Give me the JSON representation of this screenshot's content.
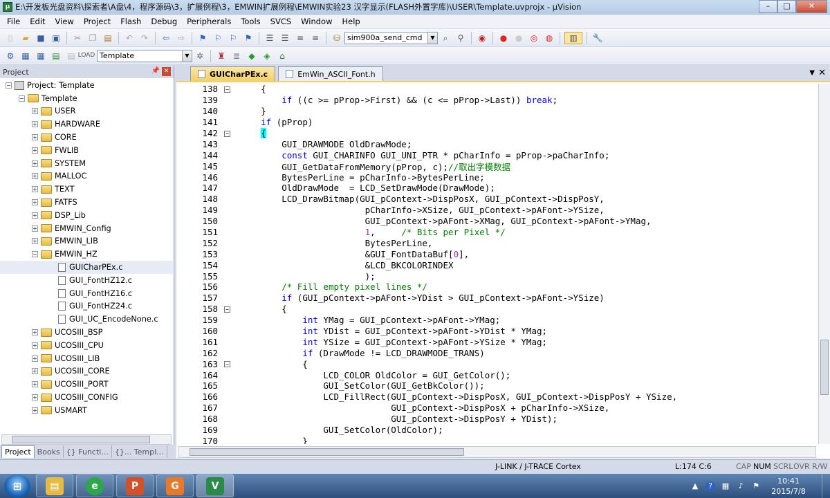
{
  "window": {
    "title": "E:\\开发板光盘资料\\探索者\\A盘\\4，程序源码\\3，扩展例程\\3，EMWIN扩展例程\\EMWIN实验23 汉字显示(FLASH外置字库)\\USER\\Template.uvprojx - µVision",
    "btn_min": "–",
    "btn_max": "□",
    "btn_close": "✕"
  },
  "menu": [
    "File",
    "Edit",
    "View",
    "Project",
    "Flash",
    "Debug",
    "Peripherals",
    "Tools",
    "SVCS",
    "Window",
    "Help"
  ],
  "toolbar": {
    "find_combo": "sim900a_send_cmd",
    "target_combo": "Template",
    "combo_arrow": "▼"
  },
  "project_panel": {
    "header": "Project",
    "pin": "📌",
    "close": "✕",
    "root": "Project: Template",
    "target": "Template",
    "groups": [
      "USER",
      "HARDWARE",
      "CORE",
      "FWLIB",
      "SYSTEM",
      "MALLOC",
      "TEXT",
      "FATFS",
      "DSP_Lib",
      "EMWIN_Config",
      "EMWIN_LIB"
    ],
    "open_group": "EMWIN_HZ",
    "open_group_files": [
      "GUICharPEx.c",
      "GUI_FontHZ12.c",
      "GUI_FontHZ16.c",
      "GUI_FontHZ24.c",
      "GUI_UC_EncodeNone.c"
    ],
    "groups_after": [
      "UCOSIII_BSP",
      "UCOSIII_CPU",
      "UCOSIII_LIB",
      "UCOSIII_CORE",
      "UCOSIII_PORT",
      "UCOSIII_CONFIG",
      "USMART"
    ],
    "expand_plus": "+",
    "expand_minus": "−",
    "tabs": [
      "Project",
      "Books",
      "{} Functi...",
      "{}... Templ..."
    ]
  },
  "editor": {
    "tabs": [
      "GUICharPEx.c",
      "EmWin_ASCII_Font.h"
    ],
    "active_tab": "GUICharPEx.c",
    "tab_dropdown": "▼",
    "tab_close": "✕",
    "fold_minus": "−",
    "lines": [
      {
        "n": "138",
        "fold": true,
        "t": "    {"
      },
      {
        "n": "139",
        "fold": false,
        "t": "        if ((c >= pProp->First) && (c <= pProp->Last)) break;"
      },
      {
        "n": "140",
        "fold": false,
        "t": "    }"
      },
      {
        "n": "141",
        "fold": false,
        "t": "    if (pProp)"
      },
      {
        "n": "142",
        "fold": true,
        "t": "    {"
      },
      {
        "n": "143",
        "fold": false,
        "t": "        GUI_DRAWMODE OldDrawMode;"
      },
      {
        "n": "144",
        "fold": false,
        "t": "        const GUI_CHARINFO GUI_UNI_PTR * pCharInfo = pProp->paCharInfo;"
      },
      {
        "n": "145",
        "fold": false,
        "t": "        GUI_GetDataFromMemory(pProp, c);//取出字模数据"
      },
      {
        "n": "146",
        "fold": false,
        "t": "        BytesPerLine = pCharInfo->BytesPerLine;"
      },
      {
        "n": "147",
        "fold": false,
        "t": "        OldDrawMode  = LCD_SetDrawMode(DrawMode);"
      },
      {
        "n": "148",
        "fold": false,
        "t": "        LCD_DrawBitmap(GUI_pContext->DispPosX, GUI_pContext->DispPosY,"
      },
      {
        "n": "149",
        "fold": false,
        "t": "                        pCharInfo->XSize, GUI_pContext->pAFont->YSize,"
      },
      {
        "n": "150",
        "fold": false,
        "t": "                        GUI_pContext->pAFont->XMag, GUI_pContext->pAFont->YMag,"
      },
      {
        "n": "151",
        "fold": false,
        "t": "                        1,     /* Bits per Pixel */"
      },
      {
        "n": "152",
        "fold": false,
        "t": "                        BytesPerLine,"
      },
      {
        "n": "153",
        "fold": false,
        "t": "                        &GUI_FontDataBuf[0],"
      },
      {
        "n": "154",
        "fold": false,
        "t": "                        &LCD_BKCOLORINDEX"
      },
      {
        "n": "155",
        "fold": false,
        "t": "                        );"
      },
      {
        "n": "156",
        "fold": false,
        "t": "        /* Fill empty pixel lines */"
      },
      {
        "n": "157",
        "fold": false,
        "t": "        if (GUI_pContext->pAFont->YDist > GUI_pContext->pAFont->YSize)"
      },
      {
        "n": "158",
        "fold": true,
        "t": "        {"
      },
      {
        "n": "159",
        "fold": false,
        "t": "            int YMag = GUI_pContext->pAFont->YMag;"
      },
      {
        "n": "160",
        "fold": false,
        "t": "            int YDist = GUI_pContext->pAFont->YDist * YMag;"
      },
      {
        "n": "161",
        "fold": false,
        "t": "            int YSize = GUI_pContext->pAFont->YSize * YMag;"
      },
      {
        "n": "162",
        "fold": false,
        "t": "            if (DrawMode != LCD_DRAWMODE_TRANS)"
      },
      {
        "n": "163",
        "fold": true,
        "t": "            {"
      },
      {
        "n": "164",
        "fold": false,
        "t": "                LCD_COLOR OldColor = GUI_GetColor();"
      },
      {
        "n": "165",
        "fold": false,
        "t": "                GUI_SetColor(GUI_GetBkColor());"
      },
      {
        "n": "166",
        "fold": false,
        "t": "                LCD_FillRect(GUI_pContext->DispPosX, GUI_pContext->DispPosY + YSize,"
      },
      {
        "n": "167",
        "fold": false,
        "t": "                             GUI_pContext->DispPosX + pCharInfo->XSize,"
      },
      {
        "n": "168",
        "fold": false,
        "t": "                             GUI_pContext->DispPosY + YDist);"
      },
      {
        "n": "169",
        "fold": false,
        "t": "                GUI_SetColor(OldColor);"
      },
      {
        "n": "170",
        "fold": false,
        "t": "            }"
      }
    ]
  },
  "status": {
    "debugger": "J-LINK / J-TRACE Cortex",
    "cursor": "L:174 C:6",
    "cap": "CAP",
    "num": "NUM",
    "scrl": "SCRL",
    "ovr": "OVR",
    "rw": "R/W"
  },
  "taskbar": {
    "time": "10:41",
    "date": "2015/7/8"
  },
  "colors": {
    "keyword": "#0000ff",
    "comment": "#008000",
    "number": "#9b30c0",
    "brace_highlight": "#00ffff",
    "active_tab": "#f6cf69"
  }
}
